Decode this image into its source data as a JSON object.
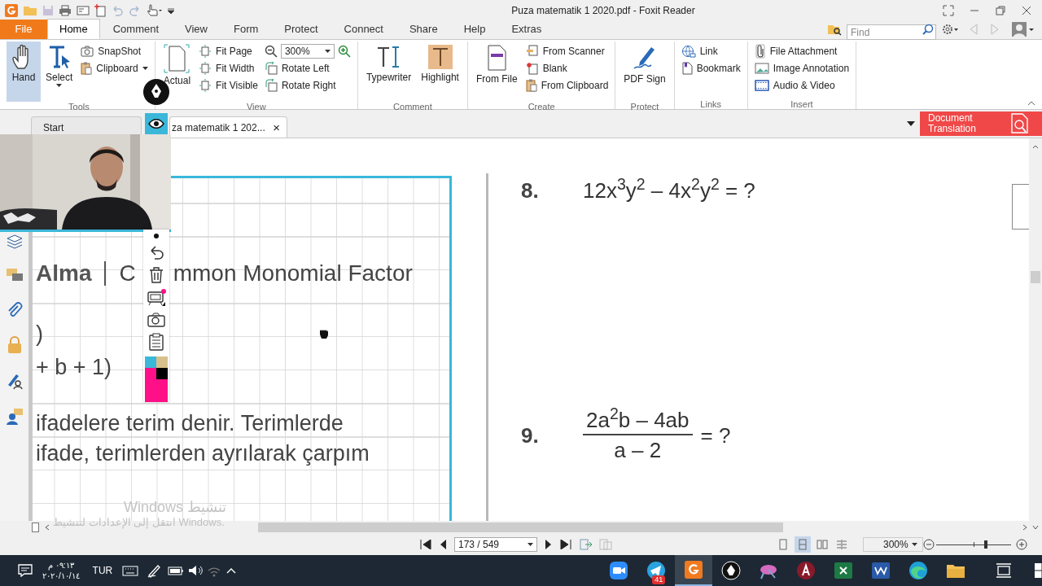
{
  "window": {
    "title": "Puza matematik 1 2020.pdf - Foxit Reader"
  },
  "menu_tabs": [
    {
      "label": "File",
      "kind": "file"
    },
    {
      "label": "Home",
      "kind": "tab",
      "selected": true
    },
    {
      "label": "Comment",
      "kind": "tab",
      "selected": false
    },
    {
      "label": "View",
      "kind": "tab",
      "selected": false
    },
    {
      "label": "Form",
      "kind": "tab",
      "selected": false
    },
    {
      "label": "Protect",
      "kind": "tab",
      "selected": false
    },
    {
      "label": "Connect",
      "kind": "tab",
      "selected": false
    },
    {
      "label": "Share",
      "kind": "tab",
      "selected": false
    },
    {
      "label": "Help",
      "kind": "tab",
      "selected": false
    },
    {
      "label": "Extras",
      "kind": "tab",
      "selected": false
    }
  ],
  "find": {
    "placeholder": "Find"
  },
  "ribbon": [
    {
      "label": "Tools",
      "items": [
        {
          "kind": "large",
          "label": "Hand",
          "selected": true
        },
        {
          "kind": "large",
          "label": "Select",
          "selected": false,
          "menu": true
        },
        {
          "kind": "small",
          "label": "SnapShot",
          "selected": false
        },
        {
          "kind": "small",
          "label": "Clipboard",
          "selected": false,
          "menu": true
        }
      ]
    },
    {
      "label": "View",
      "items": [
        {
          "kind": "large",
          "label": "Actual"
        },
        {
          "kind": "small",
          "label": "Fit Page"
        },
        {
          "kind": "small",
          "label": "Fit Width"
        },
        {
          "kind": "small",
          "label": "Fit Visible"
        },
        {
          "kind": "zoom",
          "value": "300%"
        },
        {
          "kind": "small",
          "label": "Rotate Left"
        },
        {
          "kind": "small",
          "label": "Rotate Right"
        }
      ]
    },
    {
      "label": "Comment",
      "items": [
        {
          "kind": "large",
          "label": "Typewriter"
        },
        {
          "kind": "large",
          "label": "Highlight"
        }
      ]
    },
    {
      "label": "Create",
      "items": [
        {
          "kind": "large",
          "label": "From File"
        },
        {
          "kind": "small",
          "label": "From Scanner"
        },
        {
          "kind": "small",
          "label": "Blank"
        },
        {
          "kind": "small",
          "label": "From Clipboard"
        }
      ]
    },
    {
      "label": "Protect",
      "items": [
        {
          "kind": "large",
          "label": "PDF Sign"
        }
      ]
    },
    {
      "label": "Links",
      "items": [
        {
          "kind": "small",
          "label": "Link"
        },
        {
          "kind": "small",
          "label": "Bookmark"
        }
      ]
    },
    {
      "label": "Insert",
      "items": [
        {
          "kind": "small",
          "label": "File Attachment"
        },
        {
          "kind": "small",
          "label": "Image Annotation"
        },
        {
          "kind": "small",
          "label": "Audio & Video"
        }
      ]
    }
  ],
  "doc_tabs": [
    {
      "label": "Start",
      "selected": false,
      "closable": false
    },
    {
      "label": "za matematik 1 202...",
      "selected": true,
      "closable": true
    }
  ],
  "tab_close": "×",
  "translate_button": "Document Translation",
  "palette": [
    {
      "color": "#3bb7d9"
    },
    {
      "color": "#d8c08c"
    },
    {
      "color": "#ff1089"
    },
    {
      "color": "#000000"
    }
  ],
  "left_page": {
    "heading_bold": "Alma",
    "heading_start": "C",
    "heading_rest": "mmon Monomial Factor",
    "lines": [
      ")",
      "+ b + 1)",
      "ifadelere terim denir. Terimlerde",
      "ifade, terimlerden ayrılarak çarpım"
    ]
  },
  "questions": [
    {
      "number": "8.",
      "kind": "expression",
      "expression": "12x$^{3}$y$^{2}$ – 4x$^{2}$y$^{2}$ = ?"
    },
    {
      "number": "9.",
      "kind": "fraction",
      "numerator": "2a$^{2}$b – 4ab",
      "denominator": "a – 2",
      "suffix": "= ?"
    }
  ],
  "activation": [
    "Windows تنشيط",
    "انتقل إلى الإعدادات لتنشيط Windows."
  ],
  "status_bar": {
    "page": "173 / 549",
    "zoom": "300%",
    "zoom_slider": {
      "level": 0.66
    },
    "views": [
      {
        "selected": false
      },
      {
        "selected": true
      },
      {
        "selected": false
      },
      {
        "selected": false
      }
    ]
  },
  "taskbar": {
    "time": "٠٩:١٣ م",
    "date": "٢٠٢٠/١٠/١٤",
    "language": "TUR",
    "apps": [
      {
        "selected": false
      },
      {
        "selected": false,
        "badge": "41"
      },
      {
        "selected": true
      },
      {
        "selected": false
      },
      {
        "selected": false
      },
      {
        "selected": false
      },
      {
        "selected": false
      },
      {
        "selected": false
      },
      {
        "selected": false
      },
      {
        "selected": false
      }
    ]
  }
}
